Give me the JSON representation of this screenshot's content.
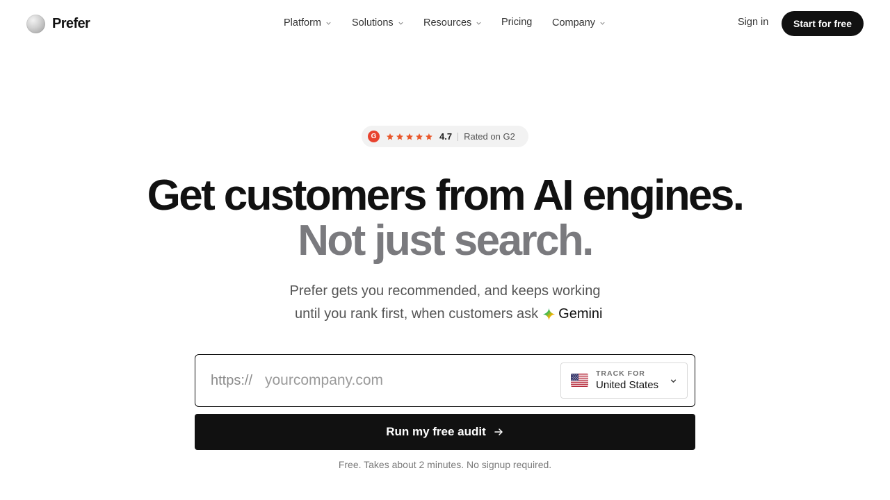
{
  "brand": {
    "name": "Prefer"
  },
  "nav": {
    "items": [
      {
        "label": "Platform",
        "has_dropdown": true
      },
      {
        "label": "Solutions",
        "has_dropdown": true
      },
      {
        "label": "Resources",
        "has_dropdown": true
      },
      {
        "label": "Pricing",
        "has_dropdown": false
      },
      {
        "label": "Company",
        "has_dropdown": true
      }
    ],
    "signin_label": "Sign in",
    "cta_label": "Start for free"
  },
  "badge": {
    "logo_text": "G",
    "rating": "4.7",
    "stars": 4.7,
    "text": "Rated on G2"
  },
  "hero": {
    "headline": "Get customers from AI engines.",
    "headline_muted": "Not just search.",
    "subline_1": "Prefer gets you recommended, and keeps working",
    "subline_2": "until you rank first, when customers ask",
    "engine_name": "Gemini",
    "engine_icon": "gemini-sparkle-icon"
  },
  "form": {
    "prefix": "https://",
    "placeholder": "yourcompany.com",
    "value": "",
    "track_label": "TRACK FOR",
    "country": "United States",
    "country_icon": "us-flag-icon",
    "submit_label": "Run my free audit",
    "note": "Free. Takes about 2 minutes. No signup required."
  },
  "colors": {
    "primary": "#111111",
    "muted_heading": "#7a7a7e",
    "g2_red": "#e8432f",
    "star_orange": "#e8562a"
  }
}
